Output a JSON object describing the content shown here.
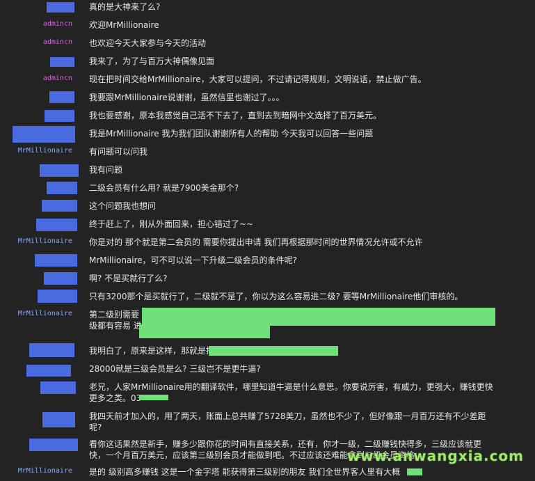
{
  "messages": [
    {
      "nick": "",
      "text": "真的是大神来了么?"
    },
    {
      "nick": "admincn",
      "text": "欢迎MrMillionaire"
    },
    {
      "nick": "admincn",
      "text": "也欢迎今天大家参与今天的活动"
    },
    {
      "nick": "",
      "text": "我来了，为了与百万大神偶像见面"
    },
    {
      "nick": "admincn",
      "text": "现在把时间交给MrMillionaire，大家可以提问，不过请记得规则，文明说话，禁止做广告。"
    },
    {
      "nick": "",
      "text": "我要跟MrMillionaire说谢谢，虽然信里也谢过了。。。"
    },
    {
      "nick": "",
      "text": "我也要感谢，原本我感觉自己活不下去了，直到去到暗网中文选择了百万美元。"
    },
    {
      "nick": "",
      "text": "我是MrMillionaire 我为我们团队谢谢所有人的帮助 今天我可以回答一些问题"
    },
    {
      "nick": "MrMillionaire",
      "text": "有问题可以问我"
    },
    {
      "nick": "",
      "text": "我有问题"
    },
    {
      "nick": "",
      "text": "二级会员有什么用? 就是7900美金那个?"
    },
    {
      "nick": "",
      "text": "这个问题我也想问"
    },
    {
      "nick": "",
      "text": "终于赶上了，刚从外面回来，担心错过了~~"
    },
    {
      "nick": "MrMillionaire",
      "text": "你是对的 那个就是第二会员的 需要你提出申请 我们再根据那时间的世界情况允许或不允许"
    },
    {
      "nick": "",
      "text": "MrMillionaire，可不可以说一下升级二级会员的条件呢?"
    },
    {
      "nick": "",
      "text": "啊? 不是买就行了么?"
    },
    {
      "nick": "",
      "text": "只有3200那个是买就行了，二级就不是了，你以为这么容易进二级? 要等MrMillionaire他们审核的。"
    },
    {
      "nick": "MrMillionaire",
      "text": "第二级别需要\n级都有容易 进\n"
    },
    {
      "nick": "",
      "text": "我明白了，原来是这样，那就是拼"
    },
    {
      "nick": "",
      "text": "28000就是三级会员是么? 三级岂不是更牛逼?"
    },
    {
      "nick": "",
      "text": "老兄，人家MrMillionaire用的翻译软件，哪里知道牛逼是什么意思。你要说厉害，有威力，更强大，赚钱更快\n更多之类。03"
    },
    {
      "nick": "",
      "text": "我四天前才加入的，用了两天，账面上总共赚了5728美刀，虽然也不少了，但好像跟一月百万还有不少差距\n呢?"
    },
    {
      "nick": "",
      "text": "看你这话果然是新手，赚多少跟你花的时间有直接关系，还有，你才一级，二级赚钱快得多，三级应该就更\n快，一个月百万美元，应该第三级别会员才能做到吧。不过应该还难能拿到三级会员资格"
    },
    {
      "nick": "MrMillionaire",
      "text": "是的 级别高多赚钱 这是一个金字塔 能获得第三级别的朋友 我们全世界客人里有大概"
    }
  ],
  "watermark": "www.anwangxia.com",
  "colors": {
    "background": "#232323",
    "admin_nick": "#d06ad0",
    "mr_nick": "#8fa6e8",
    "redaction_blue": "#4a6ae0",
    "redaction_green": "#6fe07a"
  }
}
